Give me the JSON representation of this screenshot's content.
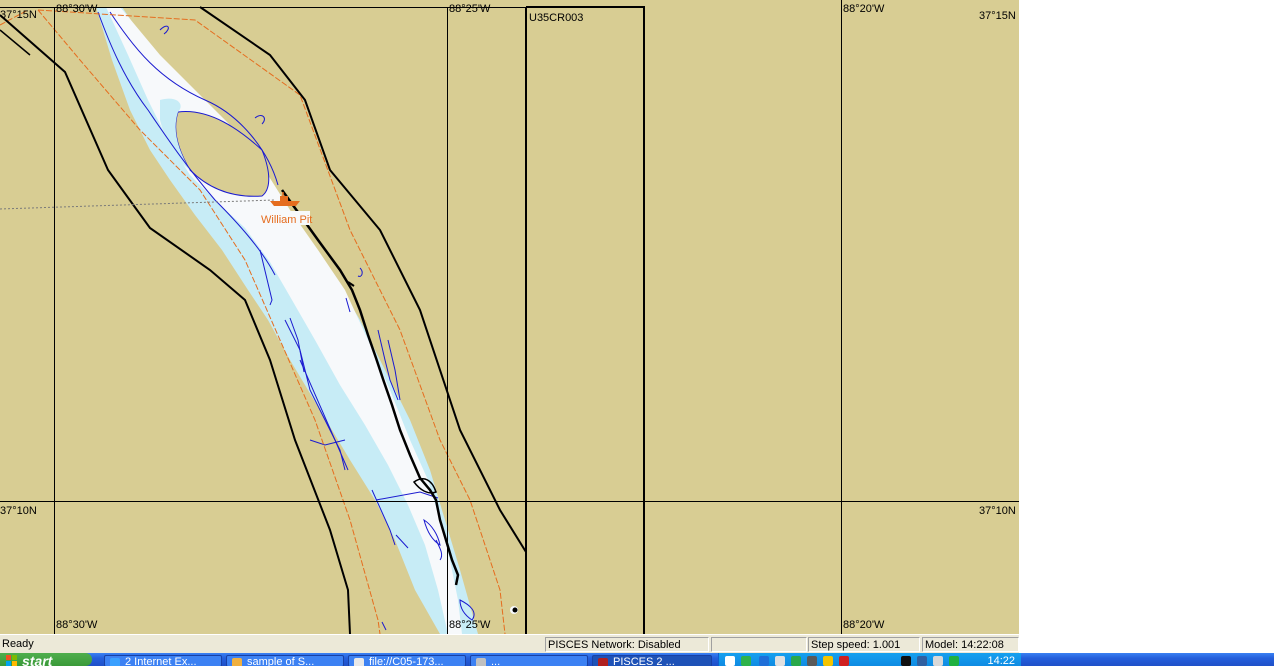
{
  "map": {
    "cell_name": "U35CR003",
    "grid": {
      "lon_top": [
        "88°30'W",
        "88°25'W",
        "88°20'W"
      ],
      "lon_bottom": [
        "88°30'W",
        "88°25'W",
        "88°20'W"
      ],
      "lat_left": [
        "37°15N",
        "37°10N"
      ],
      "lat_right": [
        "37°15N",
        "37°10N"
      ]
    },
    "vessel": {
      "name": "William Pit",
      "icon": "ship-icon",
      "color": "#e56d1f"
    },
    "colors": {
      "land": "#d8cd93",
      "deep_water": "#f7f9fb",
      "shallow_water": "#c7ecf6",
      "depth_contour": "#1a1ad0",
      "channel_limit": "#e56d1f",
      "grid_line": "#000000"
    }
  },
  "statusbar": {
    "ready": "Ready",
    "network": "PISCES Network: Disabled",
    "empty": "",
    "step_speed": "Step speed: 1.001",
    "model_time": "Model: 14:22:08"
  },
  "taskbar": {
    "start_label": "start",
    "tasks": [
      {
        "label": "2 Internet Ex...",
        "icon": "ie-icon"
      },
      {
        "label": "sample of S...",
        "icon": "folder-icon"
      },
      {
        "label": "file://C05-173...",
        "icon": "document-icon"
      },
      {
        "label": "...",
        "icon": "window-icon"
      },
      {
        "label": "PISCES 2 ...",
        "icon": "pisces-icon",
        "active": true
      }
    ],
    "clock": "14:22"
  }
}
